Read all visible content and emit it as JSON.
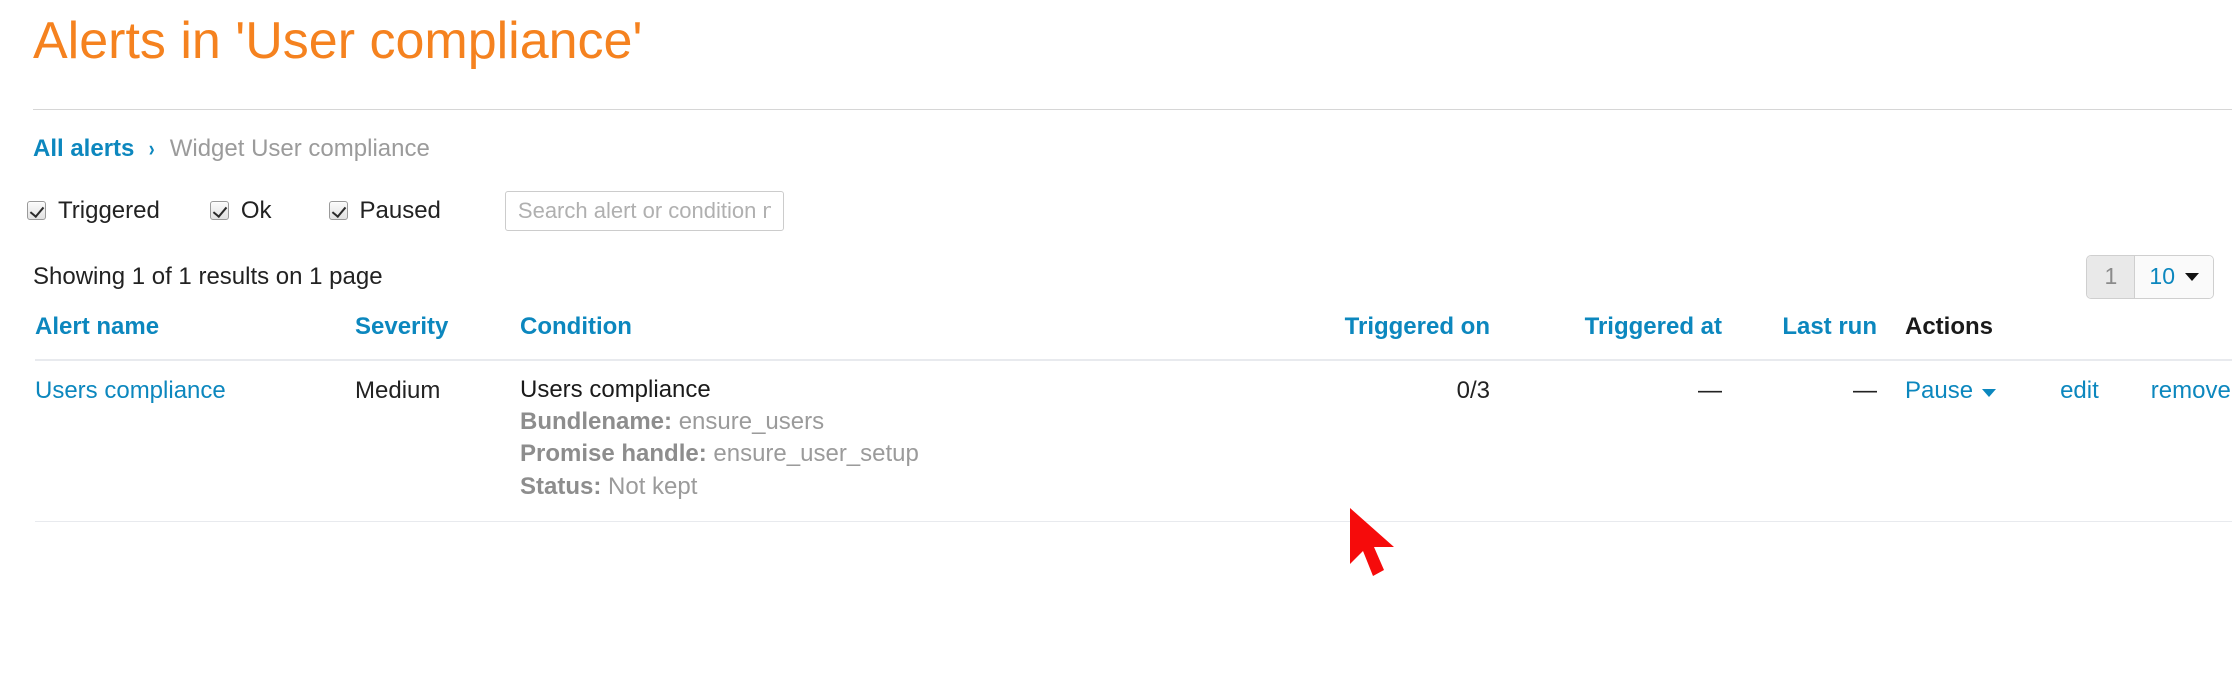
{
  "page": {
    "title": "Alerts in 'User compliance'",
    "accent_color": "#f5821f",
    "link_color": "#0c87be"
  },
  "breadcrumb": {
    "root_label": "All alerts",
    "separator": "›",
    "current_label": "Widget User compliance"
  },
  "filters": {
    "triggered_label": "Triggered",
    "ok_label": "Ok",
    "paused_label": "Paused",
    "search_placeholder": "Search alert or condition name",
    "search_value": ""
  },
  "results": {
    "summary": "Showing 1 of 1 results on 1 page",
    "page_number": "1",
    "page_size": "10"
  },
  "table": {
    "headers": {
      "alert_name": "Alert name",
      "severity": "Severity",
      "condition": "Condition",
      "triggered_on": "Triggered on",
      "triggered_at": "Triggered at",
      "last_run": "Last run",
      "actions": "Actions"
    },
    "rows": [
      {
        "alert_name": "Users compliance",
        "severity": "Medium",
        "condition_title": "Users compliance",
        "condition_bundlename_key": "Bundlename:",
        "condition_bundlename_value": "ensure_users",
        "condition_promise_key": "Promise handle:",
        "condition_promise_value": "ensure_user_setup",
        "condition_status_key": "Status:",
        "condition_status_value": "Not kept",
        "triggered_on": "0/3",
        "triggered_at": "—",
        "last_run": "—",
        "action_pause": "Pause",
        "action_edit": "edit",
        "action_remove": "remove"
      }
    ]
  },
  "cursor": {
    "color": "#f60b0b"
  }
}
